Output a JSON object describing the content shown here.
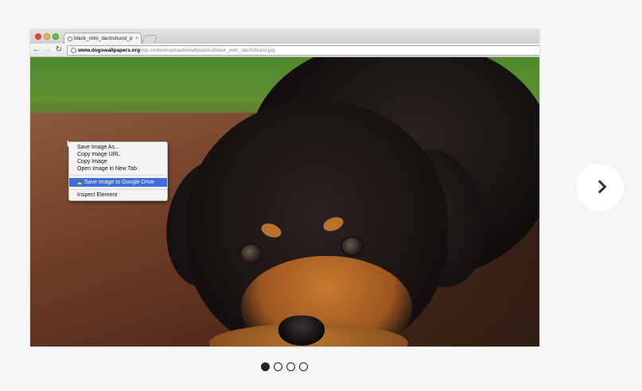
{
  "browser": {
    "tab_title": "black_mini_dachshund_pupp",
    "tab_close": "×",
    "url_host": "www.dogswallpapers.org",
    "url_path": "/wp-content/uploads/wallpapers/black_mini_dachshund.jpg",
    "nav": {
      "back": "←",
      "forward": "→",
      "reload": "↻"
    }
  },
  "context_menu": {
    "items": [
      "Save Image As...",
      "Copy Image URL",
      "Copy Image",
      "Open Image in New Tab",
      "Save Image to Google Drive",
      "Inspect Element"
    ],
    "highlighted_index": 4
  },
  "carousel": {
    "total_slides": 4,
    "active_slide": 1
  },
  "colors": {
    "menu_highlight": "#3f6dd9",
    "page_background": "#f6f6f6"
  }
}
